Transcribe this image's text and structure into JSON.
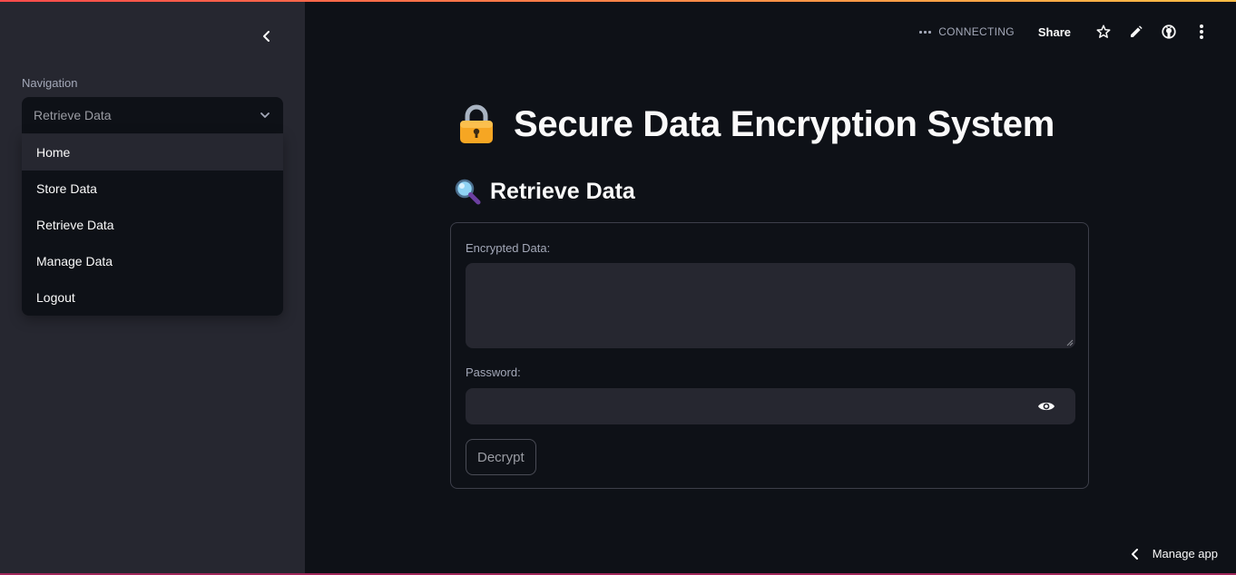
{
  "sidebar": {
    "nav_label": "Navigation",
    "selected": "Retrieve Data",
    "options": [
      "Home",
      "Store Data",
      "Retrieve Data",
      "Manage Data",
      "Logout"
    ],
    "hovered_option": "Home"
  },
  "toolbar": {
    "status": "CONNECTING",
    "share_label": "Share",
    "icons": [
      "star-icon",
      "pencil-icon",
      "github-icon",
      "more-vert-icon"
    ]
  },
  "main": {
    "title": "Secure Data Encryption System",
    "title_icon": "lock-icon",
    "subheader": "Retrieve Data",
    "subheader_icon": "magnifier-icon",
    "form": {
      "encrypted_label": "Encrypted Data:",
      "encrypted_value": "",
      "password_label": "Password:",
      "password_value": "",
      "submit_label": "Decrypt"
    }
  },
  "footer": {
    "manage_label": "Manage app"
  },
  "colors": {
    "background": "#0e1117",
    "sidebar": "#262730",
    "input": "#262730",
    "text": "#fafafa",
    "muted": "#a3a8b8"
  }
}
